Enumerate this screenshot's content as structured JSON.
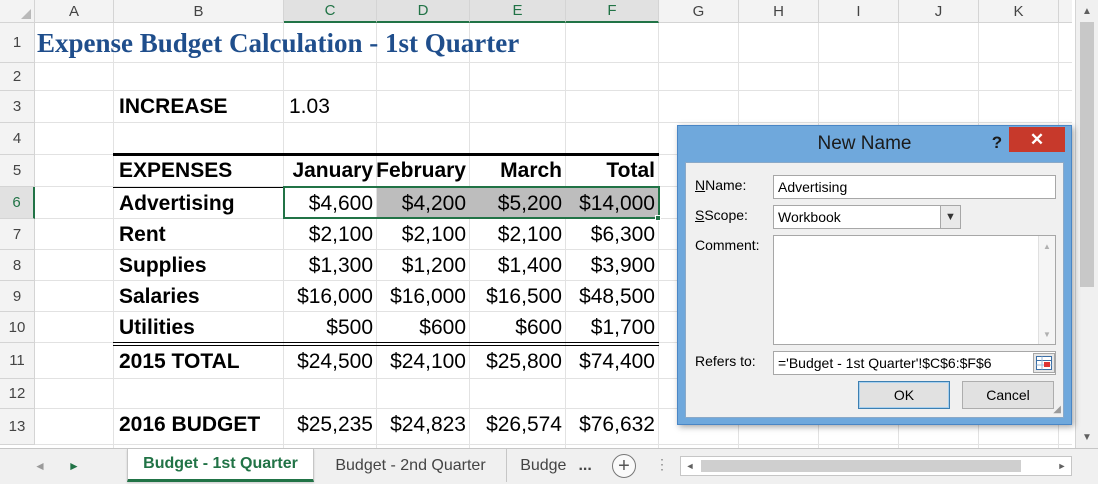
{
  "columns": [
    "A",
    "B",
    "C",
    "D",
    "E",
    "F",
    "G",
    "H",
    "I",
    "J",
    "K"
  ],
  "rows": [
    "1",
    "2",
    "3",
    "4",
    "5",
    "6",
    "7",
    "8",
    "9",
    "10",
    "11",
    "12",
    "13"
  ],
  "sheet": {
    "title": "Expense Budget Calculation - 1st Quarter",
    "increase_label": "INCREASE",
    "increase_value": "1.03",
    "header": {
      "expenses": "EXPENSES",
      "jan": "January",
      "feb": "February",
      "mar": "March",
      "total": "Total"
    },
    "expense_rows": [
      {
        "label": "Advertising",
        "jan": "$4,600",
        "feb": "$4,200",
        "mar": "$5,200",
        "total": "$14,000"
      },
      {
        "label": "Rent",
        "jan": "$2,100",
        "feb": "$2,100",
        "mar": "$2,100",
        "total": "$6,300"
      },
      {
        "label": "Supplies",
        "jan": "$1,300",
        "feb": "$1,200",
        "mar": "$1,400",
        "total": "$3,900"
      },
      {
        "label": "Salaries",
        "jan": "$16,000",
        "feb": "$16,000",
        "mar": "$16,500",
        "total": "$48,500"
      },
      {
        "label": "Utilities",
        "jan": "$500",
        "feb": "$600",
        "mar": "$600",
        "total": "$1,700"
      }
    ],
    "total_row": {
      "label": "2015 TOTAL",
      "jan": "$24,500",
      "feb": "$24,100",
      "mar": "$25,800",
      "total": "$74,400"
    },
    "budget_row": {
      "label": "2016 BUDGET",
      "jan": "$25,235",
      "feb": "$24,823",
      "mar": "$26,574",
      "total": "$76,632"
    }
  },
  "tabs": {
    "sheet1": "Budget - 1st Quarter",
    "sheet2": "Budget - 2nd Quarter",
    "sheet3": "Budge",
    "more": "...",
    "add": "+",
    "menu_dots": "⋮",
    "prev_arrow": "◄",
    "next_arrow": "►"
  },
  "dialog": {
    "title": "New Name",
    "help": "?",
    "close": "✕",
    "name_label": "Name:",
    "name_value": "Advertising",
    "scope_label": "Scope:",
    "scope_value": "Workbook",
    "comment_label": "Comment:",
    "refers_label": "Refers to:",
    "refers_value": "='Budget - 1st Quarter'!$C$6:$F$6",
    "ok": "OK",
    "cancel": "Cancel"
  },
  "colors": {
    "title": "#1f4e8c",
    "accent_green": "#217346",
    "dialog_frame": "#6fa8dc",
    "close_red": "#c7392b"
  },
  "icons": [
    "dropdown-arrow-icon",
    "range-selector-icon",
    "add-sheet-icon",
    "scroll-up-icon",
    "scroll-down-icon",
    "resize-grip-icon",
    "close-icon",
    "help-icon"
  ]
}
